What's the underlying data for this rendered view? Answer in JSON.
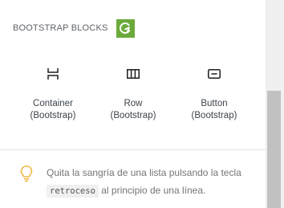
{
  "category": {
    "title": "BOOTSTRAP BLOCKS",
    "logo_color": "#6aaa3a"
  },
  "blocks": [
    {
      "icon": "container-icon",
      "label_line1": "Container",
      "label_line2": "(Bootstrap)"
    },
    {
      "icon": "row-icon",
      "label_line1": "Row",
      "label_line2": "(Bootstrap)"
    },
    {
      "icon": "button-icon",
      "label_line1": "Button",
      "label_line2": "(Bootstrap)"
    }
  ],
  "tip": {
    "icon": "lightbulb-icon",
    "icon_color": "#f0b849",
    "text_before": "Quita la sangría de una lista pulsando la tecla ",
    "code": "retroceso",
    "text_after": " al principio de una línea."
  }
}
